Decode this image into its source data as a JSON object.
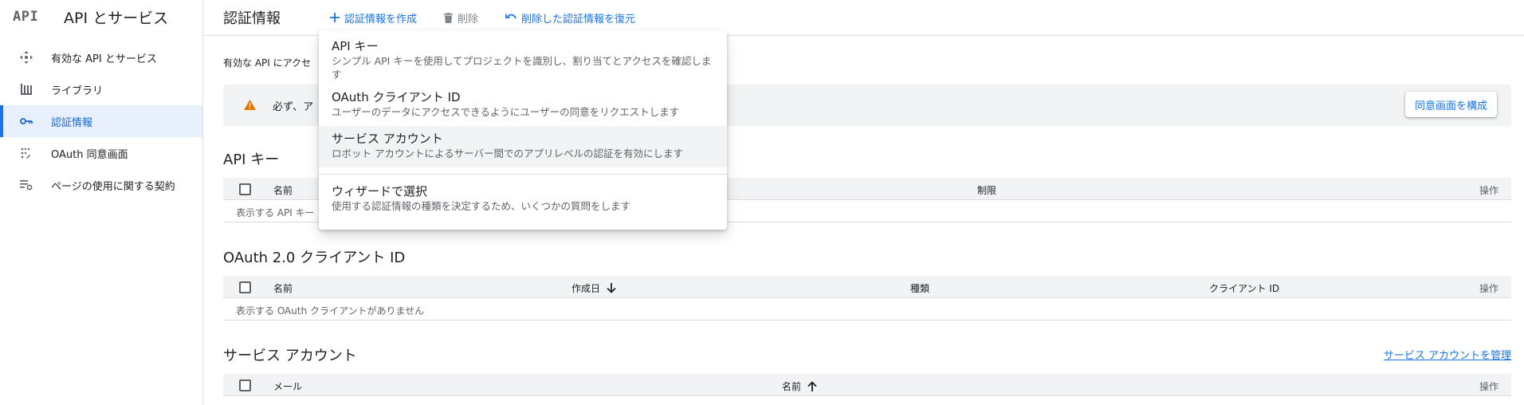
{
  "sidebar": {
    "logo": "API",
    "title": "API とサービス",
    "items": [
      {
        "label": "有効な API とサービス",
        "icon": "apis-icon"
      },
      {
        "label": "ライブラリ",
        "icon": "library-icon"
      },
      {
        "label": "認証情報",
        "icon": "key-icon"
      },
      {
        "label": "OAuth 同意画面",
        "icon": "consent-icon"
      },
      {
        "label": "ページの使用に関する契約",
        "icon": "settings-list-icon"
      }
    ],
    "active_index": 2
  },
  "topbar": {
    "title": "認証情報",
    "create_label": "認証情報を作成",
    "delete_label": "削除",
    "restore_label": "削除した認証情報を復元"
  },
  "main": {
    "intro_text": "有効な API にアクセ",
    "warning": {
      "text": "必ず、ア",
      "button_label": "同意画面を構成"
    },
    "api_keys": {
      "title": "API キー",
      "columns": [
        "名前",
        "制限",
        "操作"
      ],
      "empty_text": "表示する API キー"
    },
    "oauth_clients": {
      "title": "OAuth 2.0 クライアント ID",
      "columns": [
        "名前",
        "作成日",
        "種類",
        "クライアント ID",
        "操作"
      ],
      "empty_text": "表示する OAuth クライアントがありません"
    },
    "service_accounts": {
      "title": "サービス アカウント",
      "manage_link": "サービス アカウントを管理",
      "columns": [
        "メール",
        "名前",
        "操作"
      ]
    }
  },
  "dropdown": {
    "items": [
      {
        "label": "API キー",
        "description": "シンプル API キーを使用してプロジェクトを識別し、割り当てとアクセスを確認します"
      },
      {
        "label": "OAuth クライアント ID",
        "description": "ユーザーのデータにアクセスできるようにユーザーの同意をリクエストします"
      },
      {
        "label": "サービス アカウント",
        "description": "ロボット アカウントによるサーバー間でのアプリレベルの認証を有効にします"
      },
      {
        "label": "ウィザードで選択",
        "description": "使用する認証情報の種類を決定するため、いくつかの質問をします"
      }
    ],
    "hovered_index": 2
  },
  "colors": {
    "accent": "#1a73e8",
    "active_bg": "#e8f0fe",
    "warning": "#e37400",
    "header_bg": "#f1f3f4"
  }
}
